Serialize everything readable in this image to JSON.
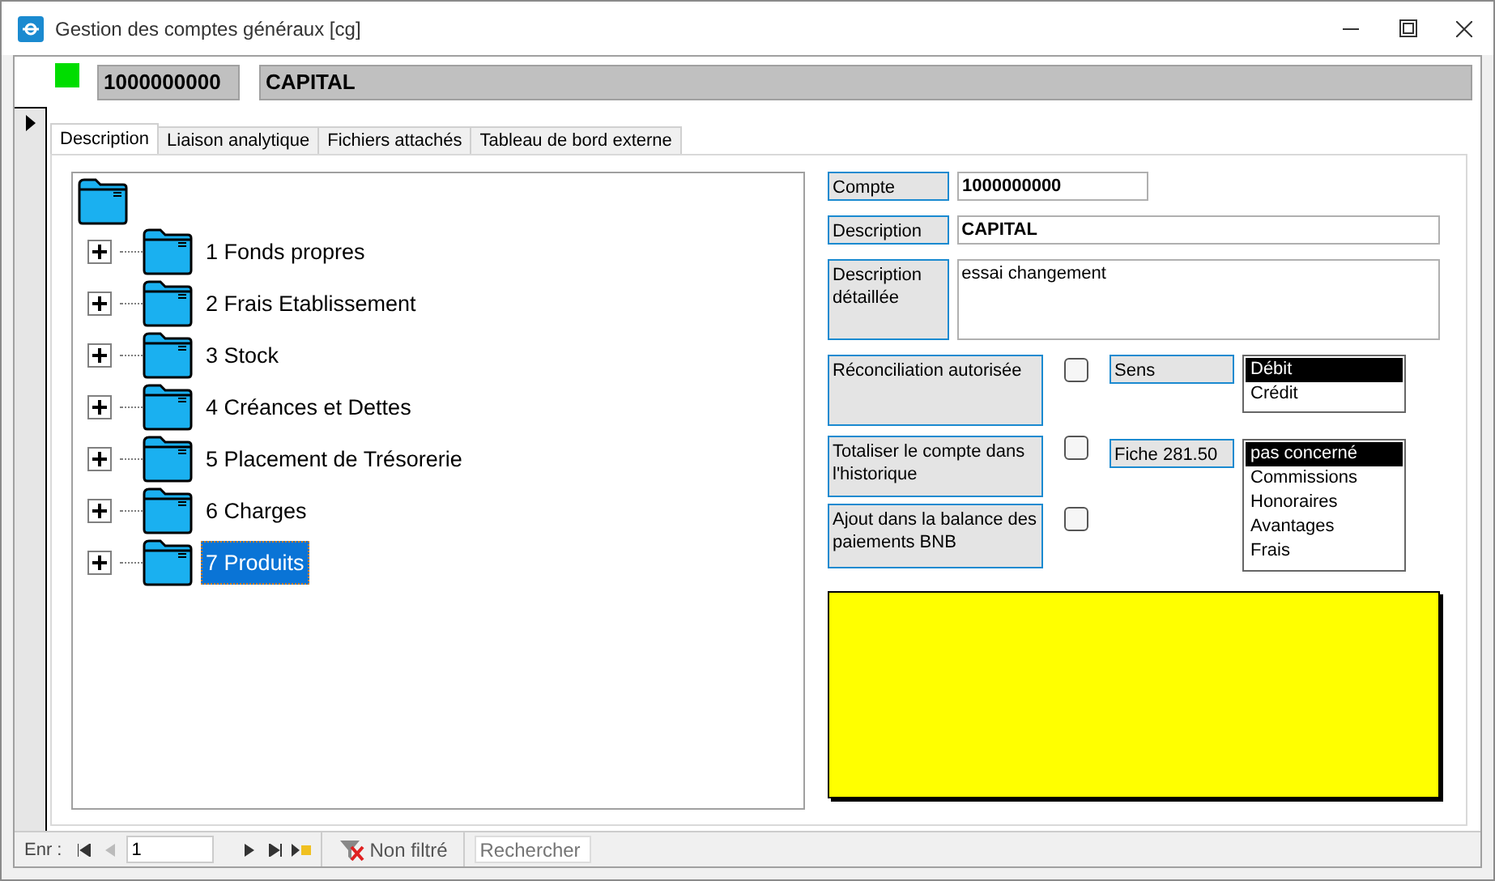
{
  "window": {
    "title": "Gestion des comptes généraux [cg]"
  },
  "header": {
    "active": true,
    "account": "1000000000",
    "name": "CAPITAL"
  },
  "tabs": [
    {
      "label": "Description",
      "selected": true
    },
    {
      "label": "Liaison analytique",
      "selected": false
    },
    {
      "label": "Fichiers attachés",
      "selected": false
    },
    {
      "label": "Tableau de bord externe",
      "selected": false
    }
  ],
  "tree": {
    "children": [
      {
        "label": "1 Fonds propres",
        "expanded": false,
        "selected": false
      },
      {
        "label": "2 Frais Etablissement",
        "expanded": false,
        "selected": false
      },
      {
        "label": "3 Stock",
        "expanded": false,
        "selected": false
      },
      {
        "label": "4 Créances et Dettes",
        "expanded": false,
        "selected": false
      },
      {
        "label": "5 Placement de Trésorerie",
        "expanded": false,
        "selected": false
      },
      {
        "label": "6 Charges",
        "expanded": false,
        "selected": false
      },
      {
        "label": "7 Produits",
        "expanded": false,
        "selected": true
      }
    ]
  },
  "fields": [
    {
      "label": "Compte",
      "value": "1000000000",
      "kind": "short"
    },
    {
      "label": "Description",
      "value": "CAPITAL",
      "kind": "wide"
    },
    {
      "label": "Description détaillée",
      "value": "essai changement",
      "kind": "memo"
    }
  ],
  "options": [
    {
      "label": "Réconciliation autorisée",
      "checked": false
    },
    {
      "label": "Totaliser le compte dans l'historique",
      "checked": false
    },
    {
      "label": "Ajout dans la balance des paiements BNB",
      "checked": false
    }
  ],
  "lists": [
    {
      "label": "Sens",
      "items": [
        {
          "label": "Débit",
          "selected": true
        },
        {
          "label": "Crédit",
          "selected": false
        }
      ]
    },
    {
      "label": "Fiche 281.50",
      "items": [
        {
          "label": "pas concerné",
          "selected": true
        },
        {
          "label": "Commissions",
          "selected": false
        },
        {
          "label": "Honoraires",
          "selected": false
        },
        {
          "label": "Avantages",
          "selected": false
        },
        {
          "label": "Frais",
          "selected": false
        }
      ]
    }
  ],
  "nav": {
    "label": "Enr :",
    "record": "1",
    "filter": "Non filtré",
    "placeholder": "Rechercher"
  }
}
